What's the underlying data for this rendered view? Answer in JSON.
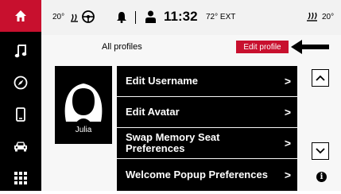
{
  "status": {
    "driver_temp": "20°",
    "clock": "11:32",
    "outside_temp": "72° EXT",
    "passenger_temp": "20°"
  },
  "sidebar": {
    "items": [
      {
        "icon": "home-icon",
        "active": true
      },
      {
        "icon": "music-note-icon"
      },
      {
        "icon": "compass-icon"
      },
      {
        "icon": "phone-icon"
      },
      {
        "icon": "car-icon"
      },
      {
        "icon": "apps-grid-icon"
      }
    ]
  },
  "header": {
    "title": "All profiles",
    "edit_profile_label": "Edit profile"
  },
  "profile": {
    "name": "Julia"
  },
  "menu": {
    "items": [
      {
        "label": "Edit Username",
        "chevron": ">"
      },
      {
        "label": "Edit Avatar",
        "chevron": ">"
      },
      {
        "label": "Swap Memory Seat Preferences",
        "chevron": ">"
      },
      {
        "label": "Welcome Popup Preferences",
        "chevron": ">"
      }
    ]
  },
  "info_label": "i",
  "colors": {
    "accent": "#c8102e",
    "sidebar": "#000000",
    "menu_bg": "#000000"
  }
}
